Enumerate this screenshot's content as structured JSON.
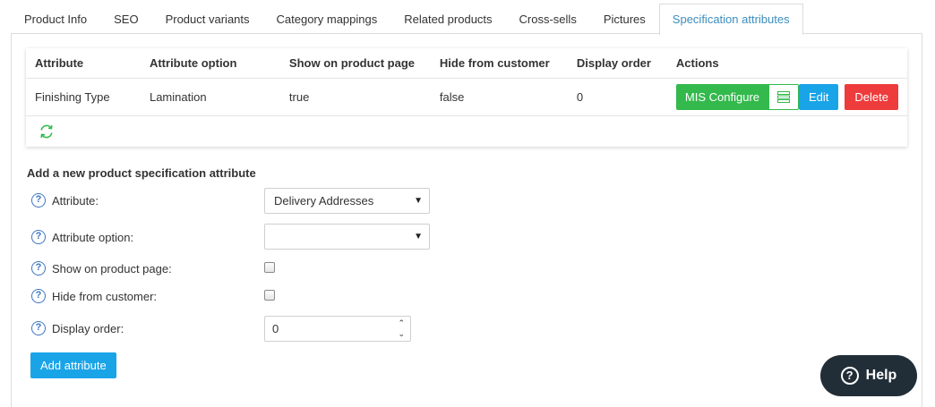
{
  "tabs": [
    {
      "label": "Product Info"
    },
    {
      "label": "SEO"
    },
    {
      "label": "Product variants"
    },
    {
      "label": "Category mappings"
    },
    {
      "label": "Related products"
    },
    {
      "label": "Cross-sells"
    },
    {
      "label": "Pictures"
    },
    {
      "label": "Specification attributes",
      "active": true
    }
  ],
  "grid": {
    "headers": {
      "attribute": "Attribute",
      "attribute_option": "Attribute option",
      "show_on_product_page": "Show on product page",
      "hide_from_customer": "Hide from customer",
      "display_order": "Display order",
      "actions": "Actions"
    },
    "rows": [
      {
        "attribute": "Finishing Type",
        "attribute_option": "Lamination",
        "show_on_product_page": "true",
        "hide_from_customer": "false",
        "display_order": "0"
      }
    ],
    "actions": {
      "mis_configure": "MIS Configure",
      "edit": "Edit",
      "delete": "Delete"
    },
    "refresh_icon": "refresh-icon"
  },
  "form": {
    "title": "Add a new product specification attribute",
    "attribute_label": "Attribute:",
    "attribute_value": "Delivery Addresses",
    "attribute_option_label": "Attribute option:",
    "attribute_option_value": "",
    "show_on_product_page_label": "Show on product page:",
    "hide_from_customer_label": "Hide from customer:",
    "display_order_label": "Display order:",
    "display_order_value": "0",
    "add_button": "Add attribute",
    "help_glyph": "?"
  },
  "help_bubble": {
    "label": "Help",
    "glyph": "?"
  },
  "colors": {
    "accent": "#3c8dbc",
    "green": "#33b94c",
    "blue": "#1aa4e8",
    "red": "#ee3b3b",
    "help_bg": "#222e37"
  }
}
